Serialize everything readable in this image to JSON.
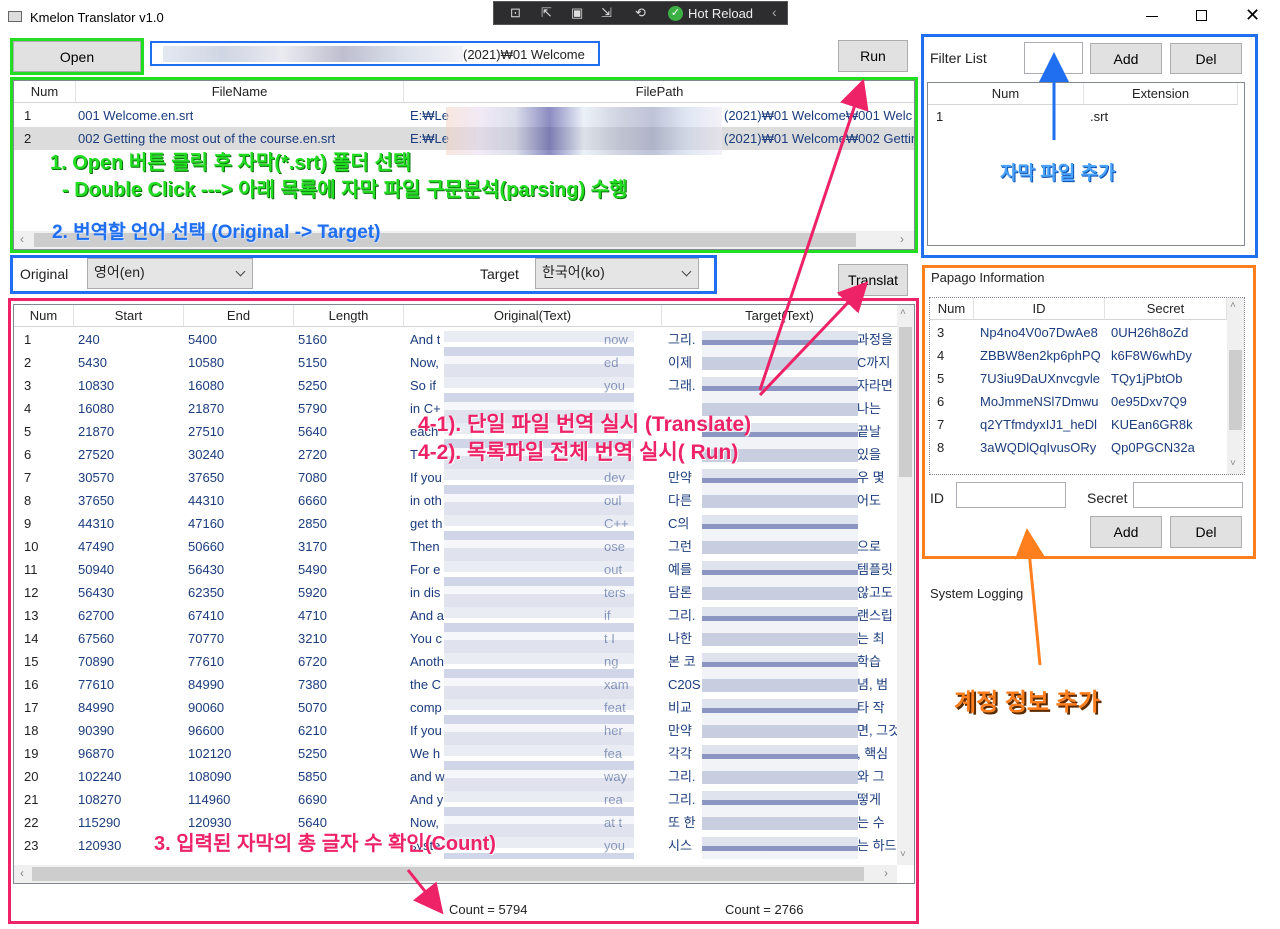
{
  "window": {
    "title": "Kmelon Translator v1.0"
  },
  "debug_toolbar": {
    "hot_reload": "Hot Reload"
  },
  "top": {
    "open_label": "Open",
    "path_value": "(2021)₩01 Welcome",
    "run_label": "Run"
  },
  "files": {
    "headers": [
      "Num",
      "FileName",
      "FilePath"
    ],
    "rows": [
      {
        "num": "1",
        "name": "001 Welcome.en.srt",
        "path_start": "E:₩Le",
        "path_end": "(2021)₩01 Welcome₩001 Welc"
      },
      {
        "num": "2",
        "name": "002 Getting the most out of the course.en.srt",
        "path_start": "E:₩Le",
        "path_end": "(2021)₩01 Welcome₩002 Gettin"
      }
    ]
  },
  "lang": {
    "original_label": "Original",
    "original_value": "영어(en)",
    "target_label": "Target",
    "target_value": "한국어(ko)",
    "translate_label": "Translat"
  },
  "subs": {
    "headers": [
      "Num",
      "Start",
      "End",
      "Length",
      "Original(Text)",
      "Target(Text)"
    ],
    "rows": [
      {
        "n": "1",
        "s": "240",
        "e": "5400",
        "l": "5160",
        "o": "And t",
        "o2": "now",
        "t": "그리.",
        "t2": "과정을"
      },
      {
        "n": "2",
        "s": "5430",
        "e": "10580",
        "l": "5150",
        "o": "Now,",
        "o2": "ed",
        "t": "이제",
        "t2": "C까지"
      },
      {
        "n": "3",
        "s": "10830",
        "e": "16080",
        "l": "5250",
        "o": "So if",
        "o2": "you",
        "t": "그래.",
        "t2": "자라면"
      },
      {
        "n": "4",
        "s": "16080",
        "e": "21870",
        "l": "5790",
        "o": "in C+",
        "o2": "",
        "t": "",
        "t2": "나는"
      },
      {
        "n": "5",
        "s": "21870",
        "e": "27510",
        "l": "5640",
        "o": "each",
        "o2": "",
        "t": "",
        "t2": "끝날"
      },
      {
        "n": "6",
        "s": "27520",
        "e": "30240",
        "l": "2720",
        "o": "T",
        "o2": "",
        "t": "",
        "t2": "있을"
      },
      {
        "n": "7",
        "s": "30570",
        "e": "37650",
        "l": "7080",
        "o": "If you",
        "o2": "dev",
        "t": "만약",
        "t2": "우 몇"
      },
      {
        "n": "8",
        "s": "37650",
        "e": "44310",
        "l": "6660",
        "o": "in oth",
        "o2": "oul",
        "t": "다른",
        "t2": "어도"
      },
      {
        "n": "9",
        "s": "44310",
        "e": "47160",
        "l": "2850",
        "o": "get th",
        "o2": "C++",
        "t": "C의",
        "t2": ""
      },
      {
        "n": "10",
        "s": "47490",
        "e": "50660",
        "l": "3170",
        "o": "Then",
        "o2": "ose",
        "t": "그런",
        "t2": "으로"
      },
      {
        "n": "11",
        "s": "50940",
        "e": "56430",
        "l": "5490",
        "o": "For e",
        "o2": "out",
        "t": "예를",
        "t2": "템플릿"
      },
      {
        "n": "12",
        "s": "56430",
        "e": "62350",
        "l": "5920",
        "o": "in dis",
        "o2": "ters",
        "t": "담론",
        "t2": "않고도"
      },
      {
        "n": "13",
        "s": "62700",
        "e": "67410",
        "l": "4710",
        "o": "And a",
        "o2": "if",
        "t": "그리.",
        "t2": "랜스립"
      },
      {
        "n": "14",
        "s": "67560",
        "e": "70770",
        "l": "3210",
        "o": "You c",
        "o2": "t I",
        "t": "나한",
        "t2": "는 최"
      },
      {
        "n": "15",
        "s": "70890",
        "e": "77610",
        "l": "6720",
        "o": "Anoth",
        "o2": "ng",
        "t": "본 코",
        "t2": "학습"
      },
      {
        "n": "16",
        "s": "77610",
        "e": "84990",
        "l": "7380",
        "o": "the C",
        "o2": "xam",
        "t": "C20S",
        "t2": "념, 범"
      },
      {
        "n": "17",
        "s": "84990",
        "e": "90060",
        "l": "5070",
        "o": "comp",
        "o2": "feat",
        "t": "비교",
        "t2": "타 작"
      },
      {
        "n": "18",
        "s": "90390",
        "e": "96600",
        "l": "6210",
        "o": "If you",
        "o2": "her",
        "t": "만약",
        "t2": "면, 그것"
      },
      {
        "n": "19",
        "s": "96870",
        "e": "102120",
        "l": "5250",
        "o": "We h",
        "o2": "fea",
        "t": "각각",
        "t2": ", 핵심"
      },
      {
        "n": "20",
        "s": "102240",
        "e": "108090",
        "l": "5850",
        "o": "and w",
        "o2": "way",
        "t": "그리.",
        "t2": "와 그"
      },
      {
        "n": "21",
        "s": "108270",
        "e": "114960",
        "l": "6690",
        "o": "And y",
        "o2": "rea",
        "t": "그리.",
        "t2": "떻게"
      },
      {
        "n": "22",
        "s": "115290",
        "e": "120930",
        "l": "5640",
        "o": "Now,",
        "o2": "at t",
        "t": "또 한",
        "t2": "는 수"
      },
      {
        "n": "23",
        "s": "120930",
        "e": "",
        "l": "",
        "o": "syste",
        "o2": "you",
        "t": "시스",
        "t2": "는 하드"
      }
    ],
    "count_original": "Count = 5794",
    "count_target": "Count = 2766"
  },
  "filter": {
    "label": "Filter List",
    "add_label": "Add",
    "del_label": "Del",
    "headers": [
      "Num",
      "Extension"
    ],
    "rows": [
      {
        "num": "1",
        "ext": ".srt"
      }
    ]
  },
  "papago": {
    "title": "Papago Information",
    "headers": [
      "Num",
      "ID",
      "Secret"
    ],
    "rows": [
      {
        "num": "3",
        "id": "Np4no4V0o7DwAe8",
        "secret": "0UH26h8oZd"
      },
      {
        "num": "4",
        "id": "ZBBW8en2kp6phPQ",
        "secret": "k6F8W6whDy"
      },
      {
        "num": "5",
        "id": "7U3iu9DaUXnvcgvle",
        "secret": "TQy1jPbtOb"
      },
      {
        "num": "6",
        "id": "MoJmmeNSl7Dmwu",
        "secret": "0e95Dxv7Q9"
      },
      {
        "num": "7",
        "id": "q2YTfmdyxIJ1_heDl",
        "secret": "KUEan6GR8k"
      },
      {
        "num": "8",
        "id": "3aWQDlQqIvusORy",
        "secret": "Qp0PGCN32a"
      }
    ],
    "id_label": "ID",
    "secret_label": "Secret",
    "add_label": "Add",
    "del_label": "Del"
  },
  "logging": {
    "label": "System Logging"
  },
  "annotations": {
    "a1_line1": "1. Open 버튼 클릭 후 자막(*.srt) 폴더 선택",
    "a1_line2": "- Double Click  ---> 아래 목록에 자막 파일 구문분석(parsing) 수행",
    "a2": "2. 번역할 언어 선택 (Original -> Target)",
    "a3": "3. 입력된 자막의 총 글자 수 확인(Count)",
    "a41": "4-1). 단일 파일 번역 실시 (Translate)",
    "a42": "4-2). 목록파일 전체 번역 실시( Run)",
    "subtitle_add": "자막 파일 추가",
    "account_add": "계정 정보 추가"
  },
  "colors": {
    "green": "#22dd22",
    "blue": "#1f6ff0",
    "pink": "#ee2266",
    "orange": "#ff7f1e"
  }
}
